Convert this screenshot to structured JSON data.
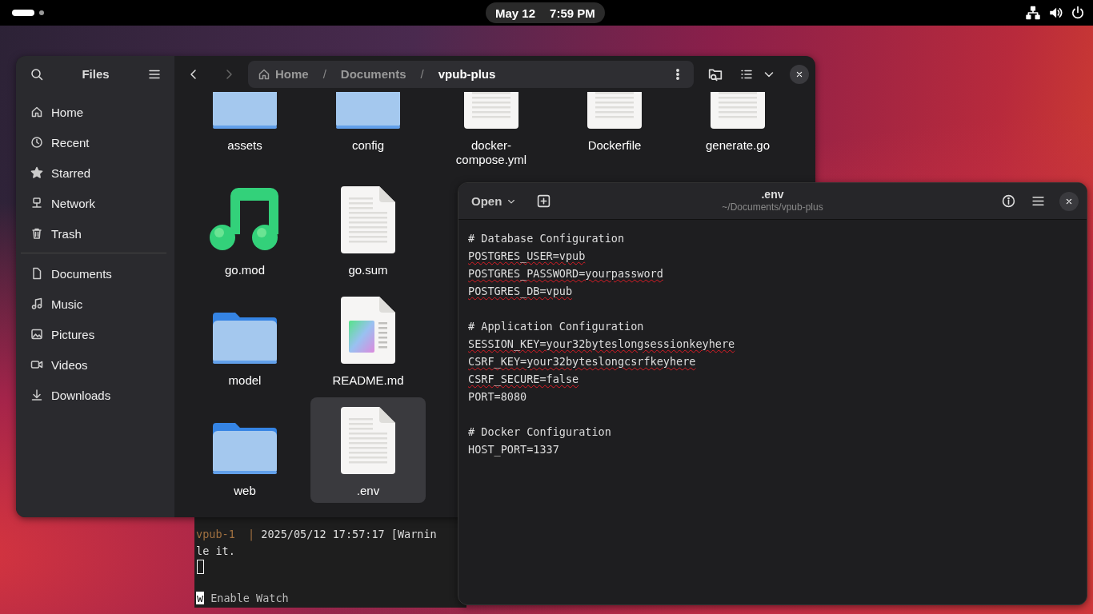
{
  "top_bar": {
    "date": "May 12",
    "time": "7:59 PM"
  },
  "terminal": {
    "lines": [
      {
        "prefix": "vpub-1  |",
        "text": " 2025/05/12 17:57:17 [Warnin"
      },
      {
        "text": "le it."
      }
    ],
    "key": "w",
    "key_label": "Enable Watch"
  },
  "files_window": {
    "title": "Files",
    "path_separator": "/",
    "back_disabled": false,
    "forward_disabled": true,
    "path": [
      {
        "label": "Home",
        "selected": false
      },
      {
        "label": "Documents",
        "selected": false
      },
      {
        "label": "vpub-plus",
        "selected": true
      }
    ],
    "places": [
      {
        "label": "Home",
        "kind": "home"
      },
      {
        "label": "Recent",
        "kind": "recent"
      },
      {
        "label": "Starred",
        "kind": "starred"
      },
      {
        "label": "Network",
        "kind": "network"
      },
      {
        "label": "Trash",
        "kind": "trash"
      }
    ],
    "bookmarks": [
      {
        "label": "Documents",
        "kind": "document"
      },
      {
        "label": "Music",
        "kind": "music"
      },
      {
        "label": "Pictures",
        "kind": "pictures"
      },
      {
        "label": "Videos",
        "kind": "videos"
      },
      {
        "label": "Downloads",
        "kind": "downloads"
      }
    ],
    "rows": [
      [
        {
          "name": "assets",
          "kind": "folder",
          "selected": false
        },
        {
          "name": "config",
          "kind": "folder",
          "selected": false
        },
        {
          "name": "docker-compose.yml",
          "kind": "text",
          "selected": false
        },
        {
          "name": "Dockerfile",
          "kind": "text",
          "selected": false
        },
        {
          "name": "generate.go",
          "kind": "text",
          "selected": false
        }
      ],
      [
        {
          "name": "go.mod",
          "kind": "audio",
          "selected": false
        },
        {
          "name": "go.sum",
          "kind": "text",
          "selected": false
        }
      ],
      [
        {
          "name": "model",
          "kind": "folder",
          "selected": false
        },
        {
          "name": "README.md",
          "kind": "markdown",
          "selected": false
        }
      ],
      [
        {
          "name": "web",
          "kind": "folder",
          "selected": false
        },
        {
          "name": ".env",
          "kind": "text",
          "selected": true
        }
      ]
    ]
  },
  "editor": {
    "open_label": "Open",
    "title": ".env",
    "subtitle": "~/Documents/vpub-plus",
    "blocks": [
      {
        "lines": [
          {
            "text": "# Database Configuration",
            "misspelled": false
          },
          {
            "text": "POSTGRES_USER=vpub",
            "misspelled": true
          },
          {
            "text": "POSTGRES_PASSWORD=yourpassword",
            "misspelled": true
          },
          {
            "text": "POSTGRES_DB=vpub",
            "misspelled": true
          }
        ]
      },
      {
        "lines": [
          {
            "text": "# Application Configuration",
            "misspelled": false
          },
          {
            "text": "SESSION_KEY=your32byteslongsessionkeyhere",
            "misspelled": true
          },
          {
            "text": "CSRF_KEY=your32byteslongcsrfkeyhere",
            "misspelled": true
          },
          {
            "text": "CSRF_SECURE=false",
            "misspelled": true
          },
          {
            "text": "PORT=8080",
            "misspelled": false
          }
        ]
      },
      {
        "lines": [
          {
            "text": "# Docker Configuration",
            "misspelled": false
          },
          {
            "text": "HOST_PORT=1337",
            "misspelled": false
          }
        ]
      }
    ]
  }
}
